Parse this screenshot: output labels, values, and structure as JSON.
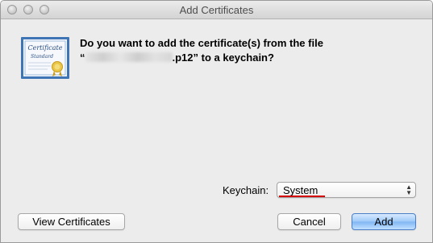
{
  "window": {
    "title": "Add Certificates"
  },
  "dialog": {
    "message_line1": "Do you want to add the certificate(s) from the file",
    "message_open_quote": "“",
    "message_suffix": ".p12” to a keychain?",
    "icon": "certificate-icon",
    "certificate_icon_text_1": "Certificate",
    "certificate_icon_text_2": "Standard"
  },
  "keychain": {
    "label": "Keychain:",
    "selected": "System"
  },
  "buttons": {
    "view_certificates": "View Certificates",
    "cancel": "Cancel",
    "add": "Add"
  },
  "colors": {
    "default_button": "#7fb5f2",
    "annotation_underline": "#d40000"
  }
}
